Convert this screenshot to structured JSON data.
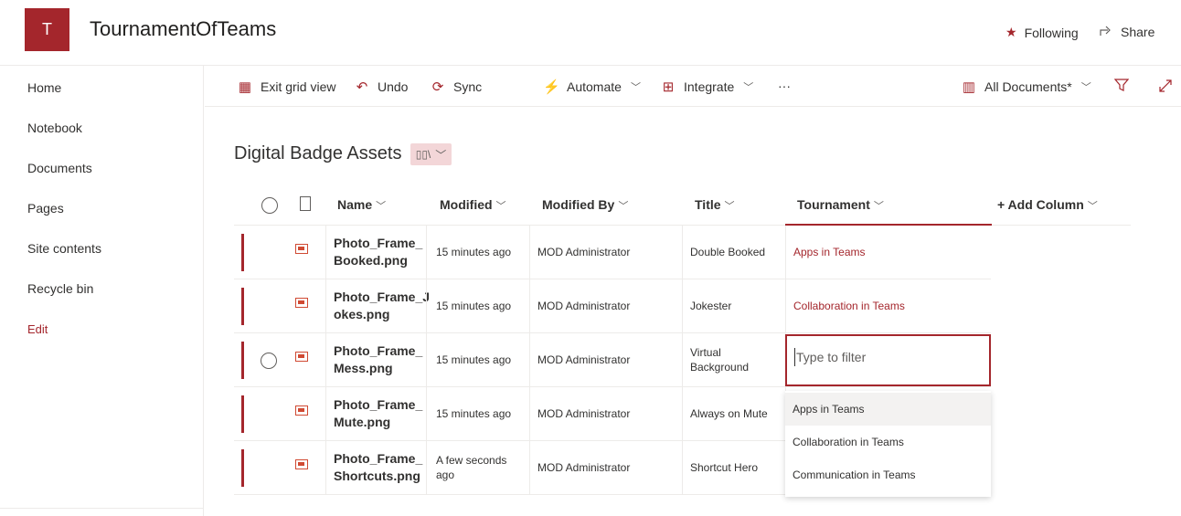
{
  "site": {
    "logo_letter": "T",
    "title": "TournamentOfTeams",
    "following_label": "Following",
    "share_label": "Share"
  },
  "nav": {
    "items": [
      {
        "label": "Home"
      },
      {
        "label": "Notebook"
      },
      {
        "label": "Documents"
      },
      {
        "label": "Pages"
      },
      {
        "label": "Site contents"
      },
      {
        "label": "Recycle bin"
      }
    ],
    "edit_label": "Edit"
  },
  "commands": {
    "exit_grid": "Exit grid view",
    "undo": "Undo",
    "sync": "Sync",
    "automate": "Automate",
    "integrate": "Integrate",
    "more": "···",
    "view": "All Documents*"
  },
  "library": {
    "title": "Digital Badge Assets"
  },
  "columns": {
    "name": "Name",
    "modified": "Modified",
    "modified_by": "Modified By",
    "title": "Title",
    "tournament": "Tournament",
    "add_column": "+ Add Column"
  },
  "rows": [
    {
      "name": "Photo_Frame_\nBooked.png",
      "modified": "15 minutes ago",
      "modified_by": "MOD Administrator",
      "title": "Double Booked",
      "tournament": "Apps in Teams"
    },
    {
      "name": "Photo_Frame_J\nokes.png",
      "modified": "15 minutes ago",
      "modified_by": "MOD Administrator",
      "title": "Jokester",
      "tournament": "Collaboration in Teams"
    },
    {
      "name": "Photo_Frame_\nMess.png",
      "modified": "15 minutes ago",
      "modified_by": "MOD Administrator",
      "title": "Virtual\nBackground",
      "tournament": ""
    },
    {
      "name": "Photo_Frame_\nMute.png",
      "modified": "15 minutes ago",
      "modified_by": "MOD Administrator",
      "title": "Always on Mute",
      "tournament": ""
    },
    {
      "name": "Photo_Frame_\nShortcuts.png",
      "modified": "A few seconds\nago",
      "modified_by": "MOD Administrator",
      "title": "Shortcut Hero",
      "tournament": ""
    }
  ],
  "filter": {
    "placeholder": "Type to filter",
    "options": [
      "Apps in Teams",
      "Collaboration in Teams",
      "Communication in Teams"
    ]
  },
  "colors": {
    "accent": "#a4262c"
  }
}
